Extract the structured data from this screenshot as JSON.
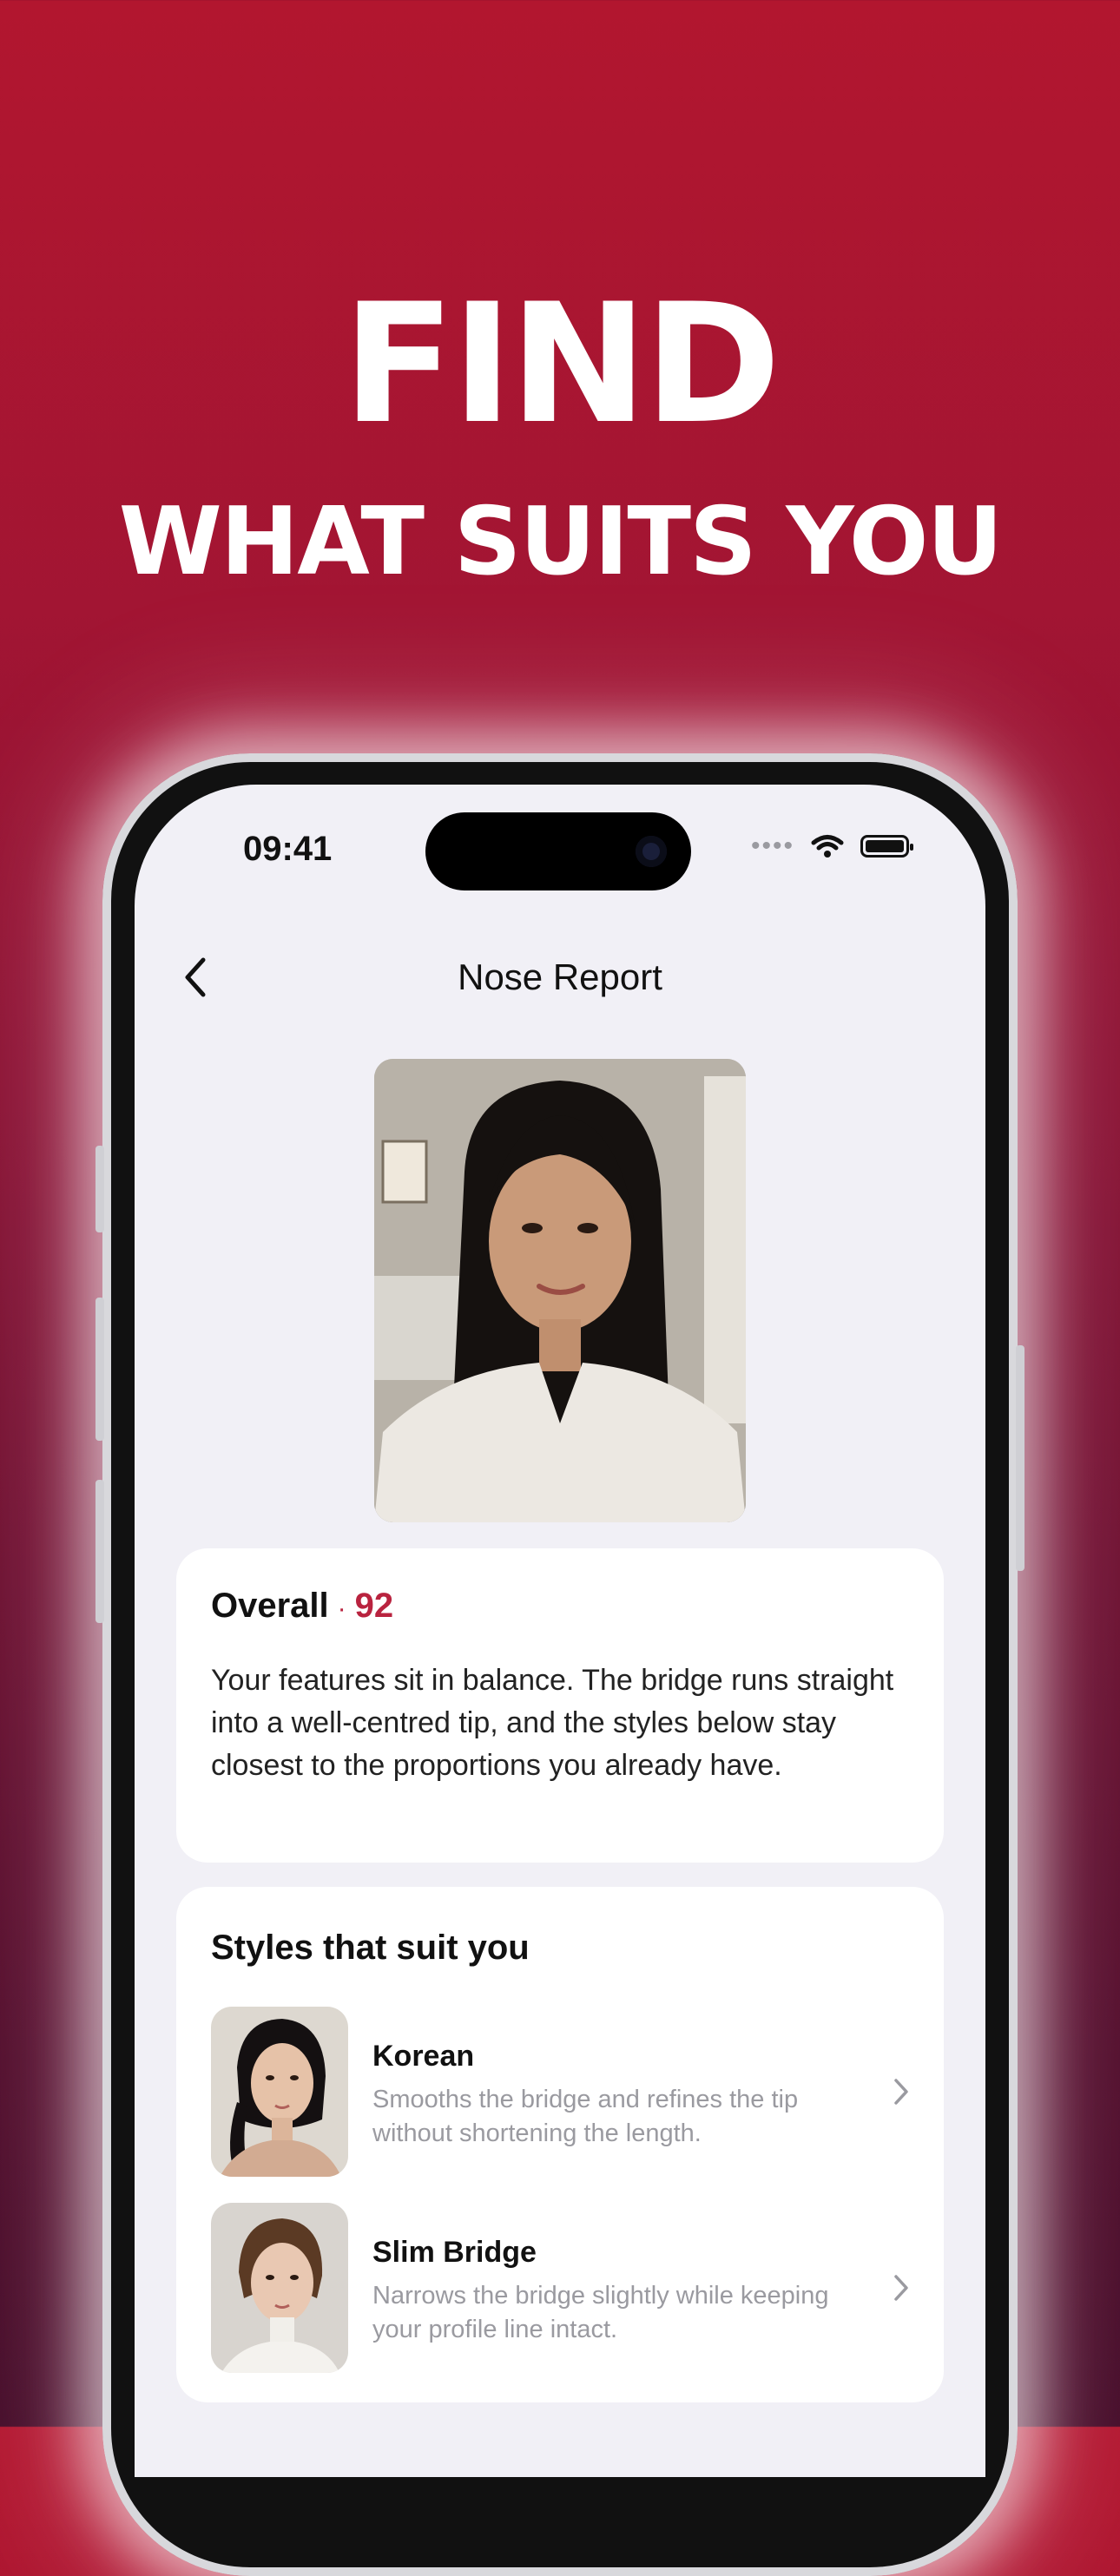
{
  "headline": {
    "line1": "FIND",
    "line2": "WHAT SUITS YOU"
  },
  "status_bar": {
    "time": "09:41"
  },
  "nav": {
    "title": "Nose Report"
  },
  "overall": {
    "label": "Overall",
    "separator": "·",
    "score": "92",
    "text": "Your features sit in balance. The bridge runs straight into a well-centred tip, and the styles below stay closest to the proportions you already have."
  },
  "styles_section": {
    "title": "Styles that suit you",
    "items": [
      {
        "name": "Korean",
        "description": "Smooths the bridge and refines the tip without shortening the length."
      },
      {
        "name": "Slim Bridge",
        "description": "Narrows the bridge slightly while keeping your profile line intact."
      }
    ]
  },
  "colors": {
    "brand": "#b2162f",
    "accent": "#b9233f",
    "background": "#f1f0f6"
  }
}
